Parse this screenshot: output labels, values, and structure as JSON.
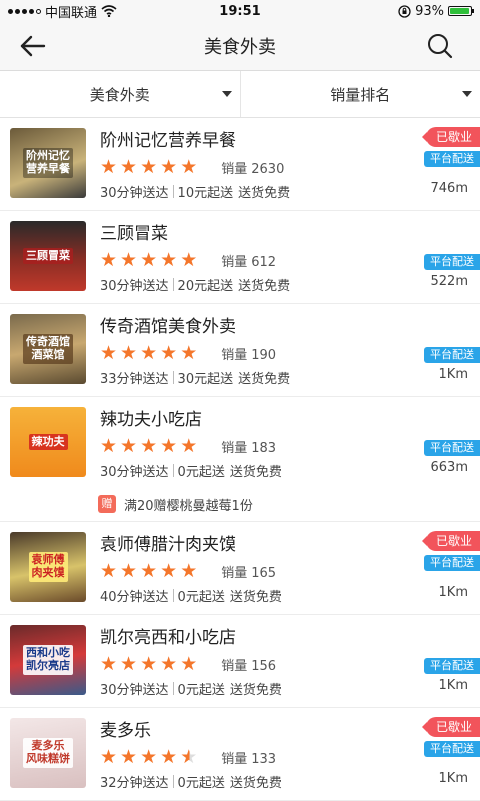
{
  "status_bar": {
    "carrier": "中国联通",
    "time": "19:51",
    "battery_percent": "93%",
    "battery_level": 0.93
  },
  "nav": {
    "title": "美食外卖",
    "back_icon": "back-arrow-icon",
    "search_icon": "search-icon"
  },
  "filters": [
    {
      "label": "美食外卖"
    },
    {
      "label": "销量排名"
    }
  ],
  "colors": {
    "star": "#f4762b",
    "badge_red": "#f2545b",
    "delivery_blue": "#2aa4e8"
  },
  "shops": [
    {
      "name": "阶州记忆营养早餐",
      "thumb_text": "阶州记忆\n营养早餐",
      "rating": 5,
      "sales_label": "销量",
      "sales": "2630",
      "delivery_time": "30分钟送达",
      "min_order": "10元起送",
      "delivery_fee": "送货免费",
      "badge": "已歇业",
      "delivery_tag": "平台配送",
      "distance": "746m"
    },
    {
      "name": "三顾冒菜",
      "thumb_text": "三顾冒菜",
      "rating": 5,
      "sales_label": "销量",
      "sales": "612",
      "delivery_time": "30分钟送达",
      "min_order": "20元起送",
      "delivery_fee": "送货免费",
      "badge": "",
      "delivery_tag": "平台配送",
      "distance": "522m"
    },
    {
      "name": "传奇酒馆美食外卖",
      "thumb_text": "传奇酒馆\n酒菜馆",
      "rating": 5,
      "sales_label": "销量",
      "sales": "190",
      "delivery_time": "33分钟送达",
      "min_order": "30元起送",
      "delivery_fee": "送货免费",
      "badge": "",
      "delivery_tag": "平台配送",
      "distance": "1Km"
    },
    {
      "name": "辣功夫小吃店",
      "thumb_text": "辣功夫",
      "rating": 5,
      "sales_label": "销量",
      "sales": "183",
      "delivery_time": "30分钟送达",
      "min_order": "0元起送",
      "delivery_fee": "送货免费",
      "badge": "",
      "delivery_tag": "平台配送",
      "distance": "663m",
      "promo_icon": "赠",
      "promo_text": "满20赠樱桃曼越莓1份"
    },
    {
      "name": "袁师傅腊汁肉夹馍",
      "thumb_text": "袁师傅\n肉夹馍",
      "rating": 5,
      "sales_label": "销量",
      "sales": "165",
      "delivery_time": "40分钟送达",
      "min_order": "0元起送",
      "delivery_fee": "送货免费",
      "badge": "已歇业",
      "delivery_tag": "平台配送",
      "distance": "1Km"
    },
    {
      "name": "凯尔亮西和小吃店",
      "thumb_text": "西和小吃\n凯尔亮店",
      "rating": 5,
      "sales_label": "销量",
      "sales": "156",
      "delivery_time": "30分钟送达",
      "min_order": "0元起送",
      "delivery_fee": "送货免费",
      "badge": "",
      "delivery_tag": "平台配送",
      "distance": "1Km"
    },
    {
      "name": "麦多乐",
      "thumb_text": "麦多乐\n风味糕饼",
      "rating": 4.5,
      "sales_label": "销量",
      "sales": "133",
      "delivery_time": "32分钟送达",
      "min_order": "0元起送",
      "delivery_fee": "送货免费",
      "badge": "已歇业",
      "delivery_tag": "平台配送",
      "distance": "1Km"
    }
  ]
}
